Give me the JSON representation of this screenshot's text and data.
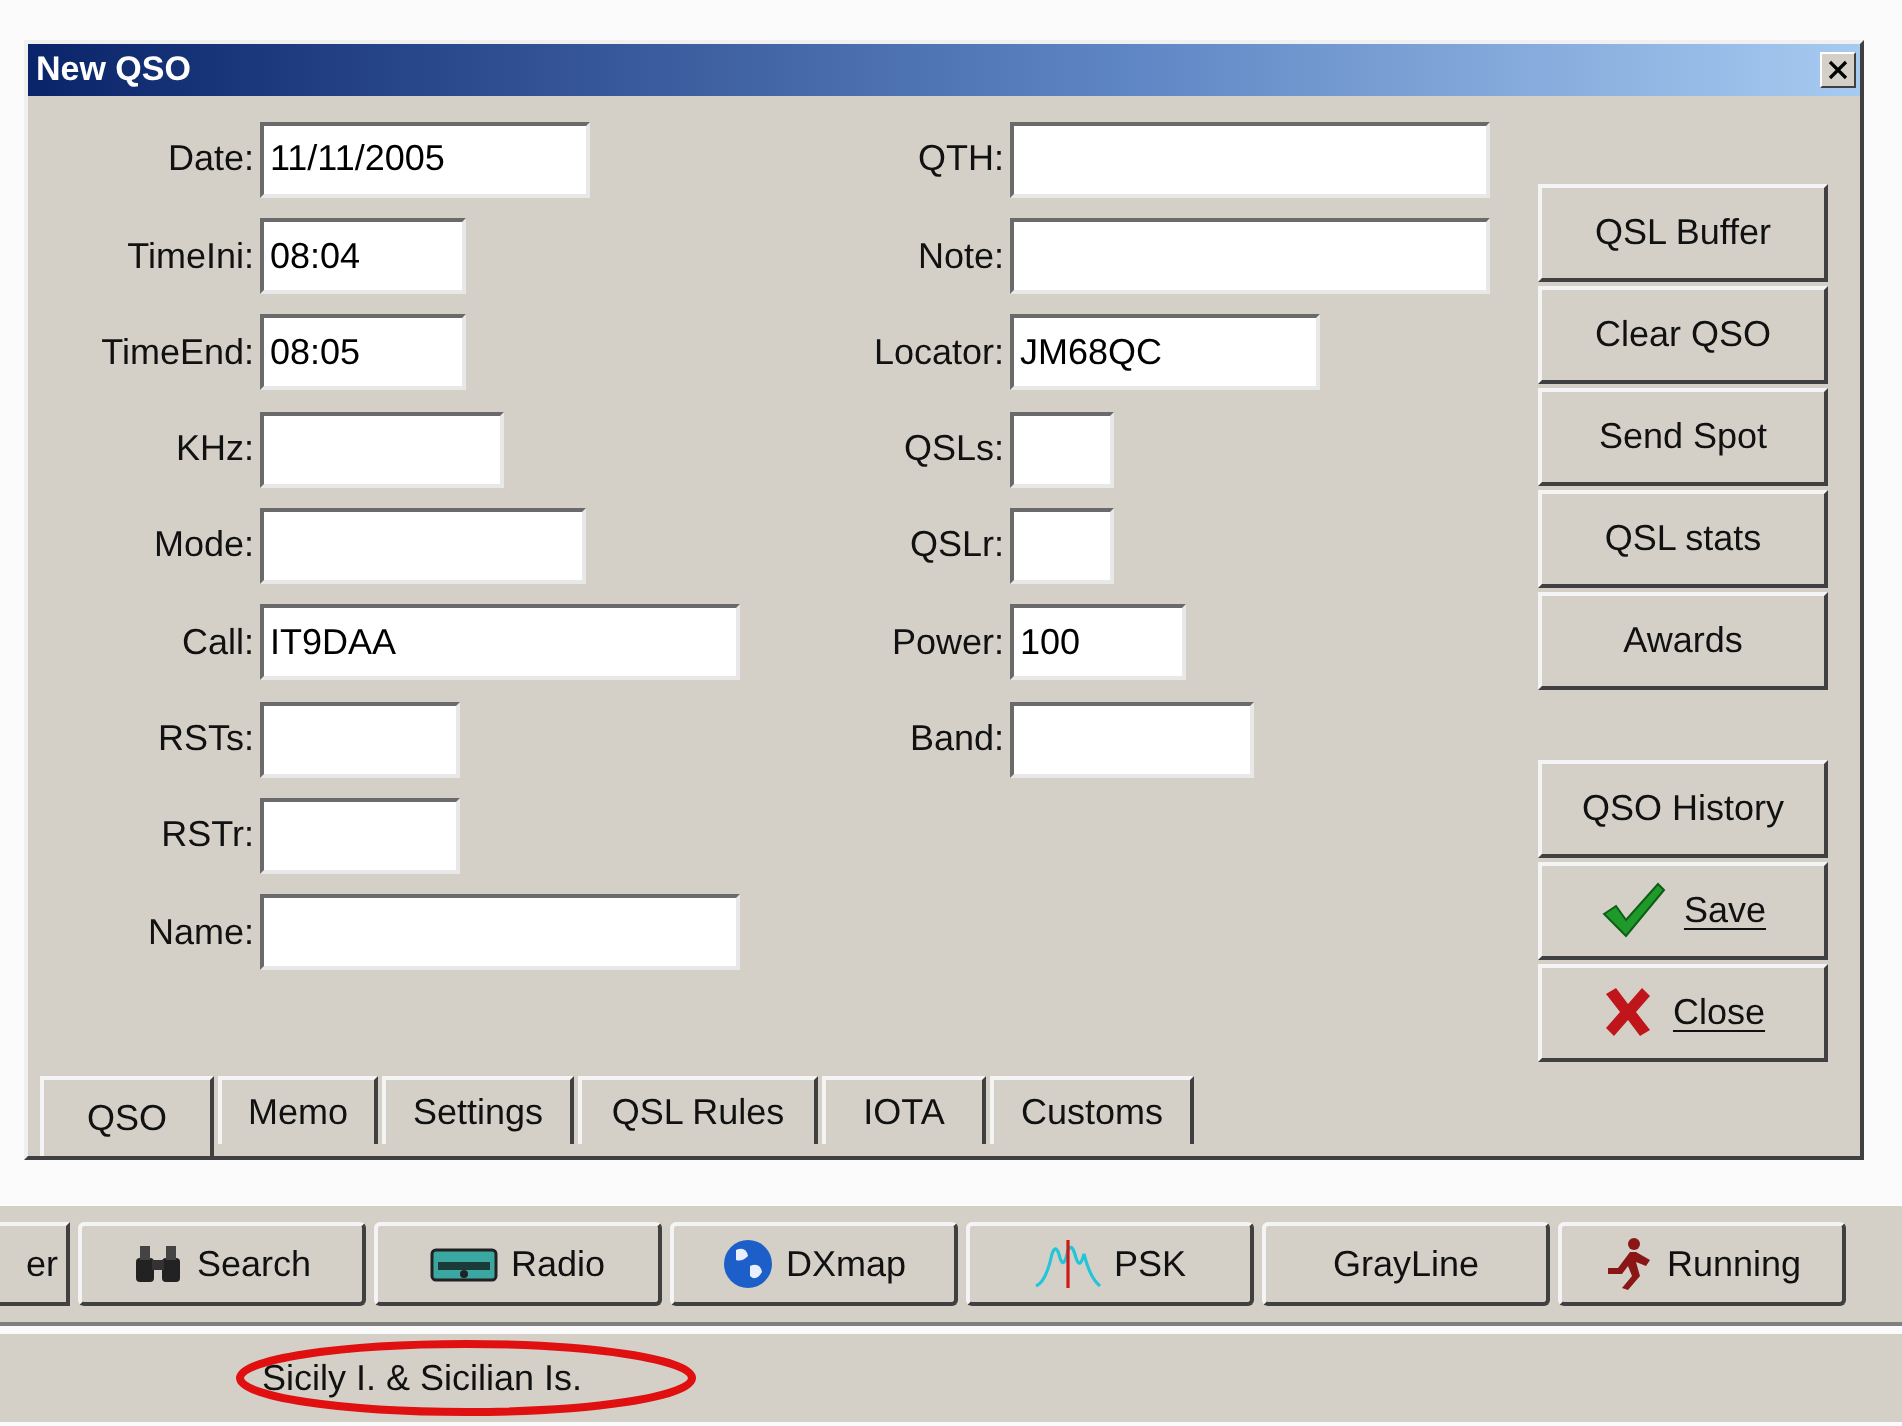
{
  "dialog": {
    "title": "New QSO",
    "left_fields": [
      {
        "label": "Date:",
        "value": "11/11/2005"
      },
      {
        "label": "TimeIni:",
        "value": "08:04"
      },
      {
        "label": "TimeEnd:",
        "value": "08:05"
      },
      {
        "label": "KHz:"
      },
      {
        "label": "Mode:"
      },
      {
        "label": "Call:",
        "value": "IT9DAA"
      },
      {
        "label": "RSTs:"
      },
      {
        "label": "RSTr:"
      },
      {
        "label": "Name:"
      }
    ],
    "right_fields": [
      {
        "label": "QTH:"
      },
      {
        "label": "Note:"
      },
      {
        "label": "Locator:",
        "value": "JM68QC"
      },
      {
        "label": "QSLs:"
      },
      {
        "label": "QSLr:"
      },
      {
        "label": "Power:",
        "value": "100"
      },
      {
        "label": "Band:"
      }
    ],
    "buttons": [
      {
        "label": "QSL Buffer",
        "kind": "plain"
      },
      {
        "label": "Clear QSO",
        "kind": "plain"
      },
      {
        "label": "Send Spot",
        "kind": "plain"
      },
      {
        "label": "QSL stats",
        "kind": "plain"
      },
      {
        "label": "Awards",
        "kind": "plain"
      },
      {
        "label": "QSO History",
        "kind": "plain"
      },
      {
        "label": "Save",
        "kind": "save"
      },
      {
        "label": "Close",
        "kind": "close"
      }
    ],
    "tabs": [
      {
        "label": "QSO",
        "selected": true
      },
      {
        "label": "Memo",
        "selected": false
      },
      {
        "label": "Settings",
        "selected": false
      },
      {
        "label": "QSL Rules",
        "selected": false
      },
      {
        "label": "IOTA",
        "selected": false
      },
      {
        "label": "Customs",
        "selected": false
      }
    ]
  },
  "toolbar": [
    {
      "label": "er",
      "kind": "none"
    },
    {
      "label": "Search",
      "kind": "binoculars"
    },
    {
      "label": "Radio",
      "kind": "radio"
    },
    {
      "label": "DXmap",
      "kind": "globe"
    },
    {
      "label": "PSK",
      "kind": "psk"
    },
    {
      "label": "GrayLine",
      "kind": "none"
    },
    {
      "label": "Running",
      "kind": "runner"
    }
  ],
  "status_bar": {
    "text": "Sicily I. & Sicilian Is.",
    "circled": true
  }
}
